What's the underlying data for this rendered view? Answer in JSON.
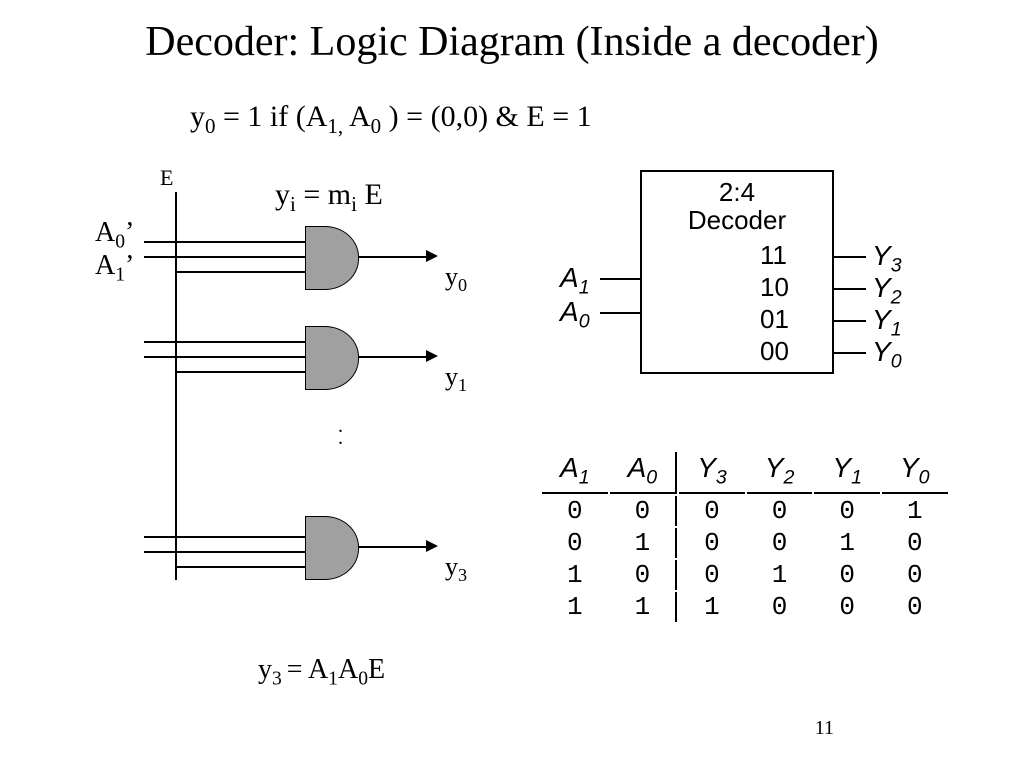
{
  "title": "Decoder: Logic Diagram (Inside a decoder)",
  "eq1_html": "y<sub>0</sub> = 1 if (A<sub>1,</sub> A<sub>0</sub> ) = (0,0) &amp; E = 1",
  "eq2_html": "y<sub>i</sub> = m<sub>i</sub> E",
  "eq3_html": "y<sub>3 </sub>= A<sub>1</sub>A<sub>0</sub>E",
  "labels": {
    "E": "E",
    "A0p_html": "A<sub>0</sub>’",
    "A1p_html": "A<sub>1</sub>’",
    "y0_html": "y<sub>0</sub>",
    "y1_html": "y<sub>1</sub>",
    "y3_html": "y<sub>3</sub>"
  },
  "decoder": {
    "title_line1": "2:4",
    "title_line2": "Decoder",
    "inputs": [
      {
        "name": "A",
        "sub": "1"
      },
      {
        "name": "A",
        "sub": "0"
      }
    ],
    "outputs": [
      {
        "code": "11",
        "name": "Y",
        "sub": "3"
      },
      {
        "code": "10",
        "name": "Y",
        "sub": "2"
      },
      {
        "code": "01",
        "name": "Y",
        "sub": "1"
      },
      {
        "code": "00",
        "name": "Y",
        "sub": "0"
      }
    ]
  },
  "truth_table": {
    "headers": [
      {
        "n": "A",
        "s": "1"
      },
      {
        "n": "A",
        "s": "0"
      },
      {
        "n": "Y",
        "s": "3"
      },
      {
        "n": "Y",
        "s": "2"
      },
      {
        "n": "Y",
        "s": "1"
      },
      {
        "n": "Y",
        "s": "0"
      }
    ],
    "rows": [
      [
        "0",
        "0",
        "0",
        "0",
        "0",
        "1"
      ],
      [
        "0",
        "1",
        "0",
        "0",
        "1",
        "0"
      ],
      [
        "1",
        "0",
        "0",
        "1",
        "0",
        "0"
      ],
      [
        "1",
        "1",
        "1",
        "0",
        "0",
        "0"
      ]
    ]
  },
  "page_number": "11"
}
